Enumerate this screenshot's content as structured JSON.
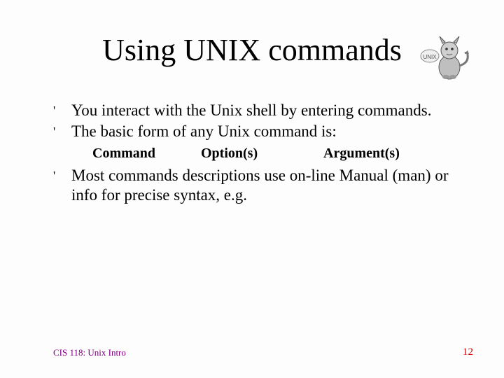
{
  "title": "Using UNIX commands",
  "bullets": {
    "b1": "You interact with the Unix shell by entering commands.",
    "b2": "The basic form of any Unix command is:",
    "syntax": {
      "command": "Command",
      "options": "Option(s)",
      "arguments": "Argument(s)"
    },
    "b3": "Most commands descriptions use on-line Manual (man) or info for precise syntax, e.g."
  },
  "footer": {
    "left": "CIS 118: Unix Intro",
    "right": "12"
  },
  "bullet_char": "'"
}
